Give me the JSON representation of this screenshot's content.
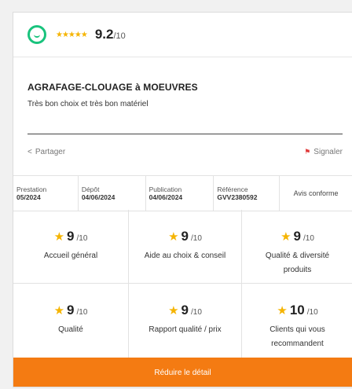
{
  "header": {
    "stars": "★★★★★",
    "score": "9.2",
    "score_den": "/10"
  },
  "review": {
    "title": "AGRAFAGE-CLOUAGE à MOEUVRES",
    "comment": "Très bon choix et très bon matériel"
  },
  "actions": {
    "share_icon": "<",
    "share_label": "Partager",
    "report_icon": "⚑",
    "report_label": "Signaler"
  },
  "meta": [
    {
      "label": "Prestation",
      "value": "05/2024"
    },
    {
      "label": "Dépôt",
      "value": "04/06/2024"
    },
    {
      "label": "Publication",
      "value": "04/06/2024"
    },
    {
      "label": "Référence",
      "value": "GVV2380592"
    }
  ],
  "meta_conform": "Avis conforme",
  "ratings": [
    {
      "score": "9",
      "den": "/10",
      "label": "Accueil général"
    },
    {
      "score": "9",
      "den": "/10",
      "label": "Aide au choix & conseil"
    },
    {
      "score": "9",
      "den": "/10",
      "label": "Qualité & diversité produits"
    },
    {
      "score": "9",
      "den": "/10",
      "label": "Qualité"
    },
    {
      "score": "9",
      "den": "/10",
      "label": "Rapport qualité / prix"
    },
    {
      "score": "10",
      "den": "/10",
      "label": "Clients qui vous recommandent"
    }
  ],
  "star_glyph": "★",
  "button_label": "Réduire le détail",
  "colors": {
    "accent": "#f47b12",
    "star": "#f5b400",
    "logo": "#19c37d",
    "report": "#e03a3a"
  }
}
